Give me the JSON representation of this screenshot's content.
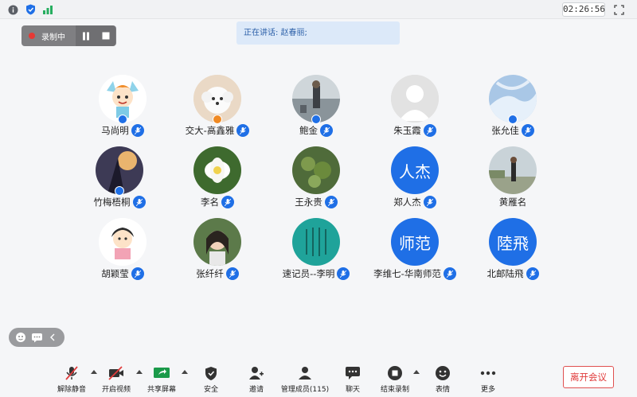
{
  "topbar": {
    "icons": [
      "info-icon",
      "shield-icon",
      "signal-icon"
    ],
    "clock": "02:26:56",
    "fullscreen_icon": "fullscreen-icon"
  },
  "speaking": {
    "text": "正在讲话: 赵春丽;"
  },
  "recording": {
    "label": "录制中",
    "pause_icon": "pause-icon",
    "stop_icon": "stop-icon"
  },
  "participants": [
    {
      "name": "马尚明",
      "avatar": "cartoon"
    },
    {
      "name": "交大-高鑫雅",
      "avatar": "dog"
    },
    {
      "name": "鲍金",
      "avatar": "photo-beach"
    },
    {
      "name": "朱玉霞",
      "avatar": "default"
    },
    {
      "name": "张允佳",
      "avatar": "sky"
    },
    {
      "name": "竹梅梧桐",
      "avatar": "art"
    },
    {
      "name": "李名",
      "avatar": "flower"
    },
    {
      "name": "王永贵",
      "avatar": "plant"
    },
    {
      "name": "郑人杰",
      "avatar_text": "人杰"
    },
    {
      "name": "黄雁名",
      "avatar": "photo-person"
    },
    {
      "name": "胡颖莹",
      "avatar": "cartoon-girl"
    },
    {
      "name": "张纤纤",
      "avatar": "photo-girl"
    },
    {
      "name": "速记员--李明",
      "avatar": "calligraphy"
    },
    {
      "name": "李维七-华南师范",
      "avatar_text": "师范"
    },
    {
      "name": "北邮陆飛",
      "avatar_text": "陸飛"
    }
  ],
  "toolbar": {
    "unmute": "解除静音",
    "video": "开启视频",
    "share": "共享屏幕",
    "security": "安全",
    "invite": "邀请",
    "members": "管理成员(115)",
    "chat": "聊天",
    "stop_record": "结束录制",
    "reaction": "表情",
    "more": "更多",
    "leave": "离开会议"
  },
  "colors": {
    "accent": "#1f6fe6",
    "danger": "#e03c3c"
  }
}
